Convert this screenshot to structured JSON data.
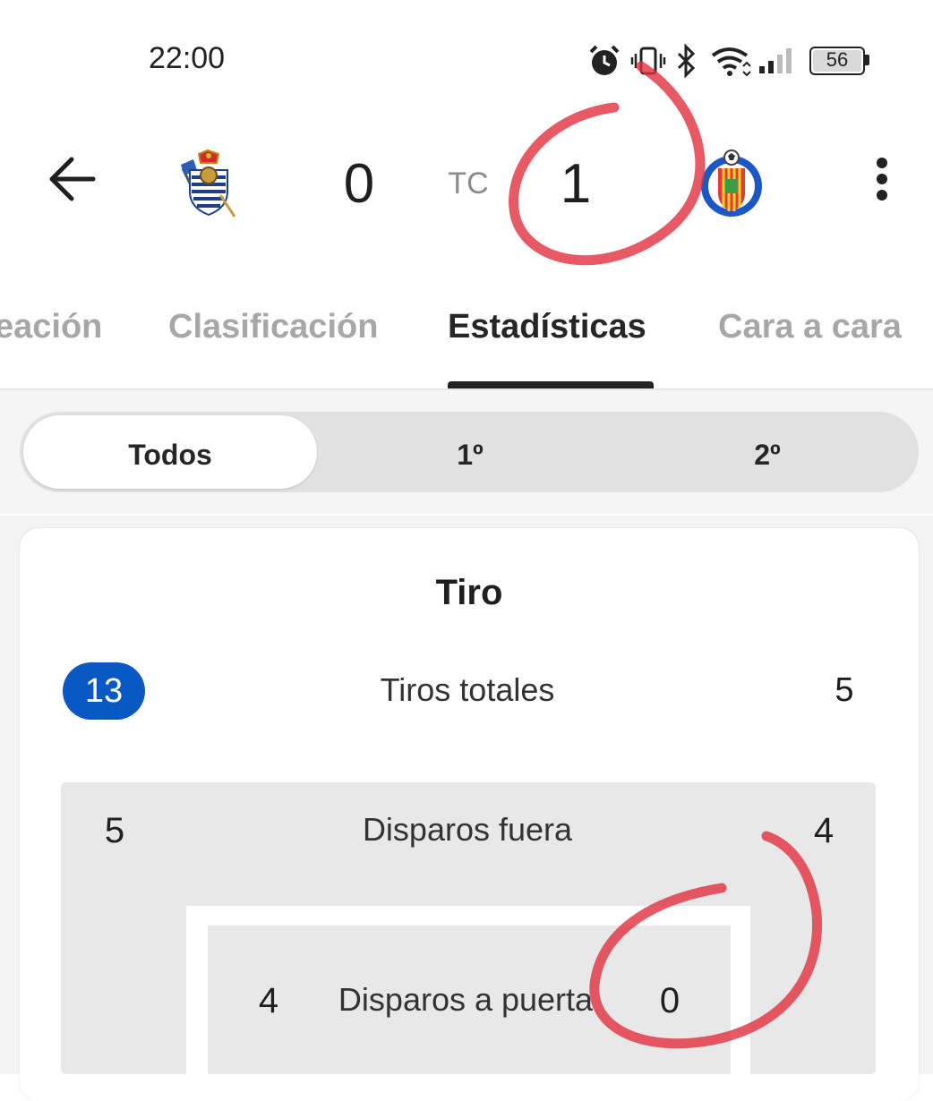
{
  "status_bar": {
    "time": "22:00",
    "battery_level": "56",
    "icons": [
      "alarm-icon",
      "vibrate-icon",
      "bluetooth-icon",
      "wifi-icon",
      "signal-icon",
      "battery-icon"
    ]
  },
  "match": {
    "home_score": "0",
    "status": "TC",
    "away_score": "1",
    "home_logo_icon": "real-sociedad-crest-icon",
    "away_logo_icon": "getafe-crest-icon"
  },
  "tabs": [
    {
      "label": "eación",
      "active": false
    },
    {
      "label": "Clasificación",
      "active": false
    },
    {
      "label": "Estadísticas",
      "active": true
    },
    {
      "label": "Cara a cara",
      "active": false
    }
  ],
  "period_selector": {
    "options": [
      {
        "label": "Todos",
        "selected": true
      },
      {
        "label": "1º",
        "selected": false
      },
      {
        "label": "2º",
        "selected": false
      }
    ]
  },
  "stats": {
    "section_title": "Tiro",
    "rows": [
      {
        "label": "Tiros totales",
        "home": "13",
        "away": "5"
      },
      {
        "label": "Disparos fuera",
        "home": "5",
        "away": "4"
      },
      {
        "label": "Disparos a puerta",
        "home": "4",
        "away": "0"
      }
    ]
  },
  "colors": {
    "highlight_blue": "#0a58c2",
    "annotation_red": "#e0303f",
    "tab_inactive": "#a7a7a7",
    "tab_active": "#262626"
  }
}
